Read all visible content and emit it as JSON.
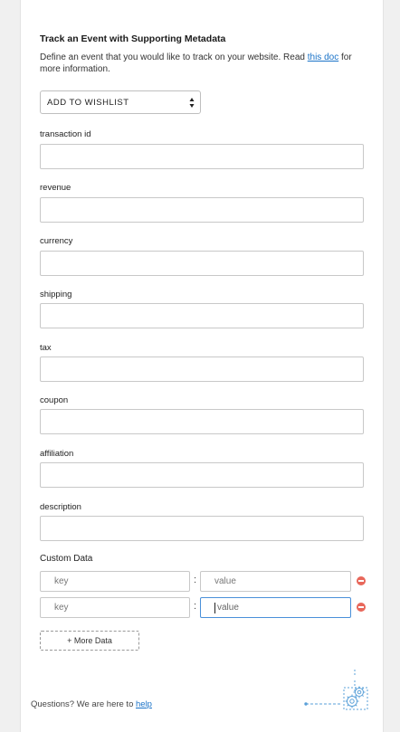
{
  "header": {
    "title": "Track an Event with Supporting Metadata",
    "desc_prefix": "Define an event that you would like to track on your website. Read ",
    "desc_link": "this doc",
    "desc_suffix": " for more information."
  },
  "event_select": {
    "value": "ADD TO WISHLIST"
  },
  "fields": [
    {
      "label": "transaction id"
    },
    {
      "label": "revenue"
    },
    {
      "label": "currency"
    },
    {
      "label": "shipping"
    },
    {
      "label": "tax"
    },
    {
      "label": "coupon"
    },
    {
      "label": "affiliation"
    },
    {
      "label": "description"
    }
  ],
  "custom_data": {
    "title": "Custom Data",
    "rows": [
      {
        "key_placeholder": "key",
        "value_placeholder": "value"
      },
      {
        "key_placeholder": "key",
        "value_placeholder": "value"
      }
    ],
    "separator": ":",
    "more_button": "+ More Data"
  },
  "footer": {
    "text": "Questions? We are here to ",
    "link": "help"
  },
  "colors": {
    "link": "#1a73c8",
    "remove": "#e8675a",
    "focus": "#4a90d9",
    "illustration": "#5aa0d8"
  }
}
